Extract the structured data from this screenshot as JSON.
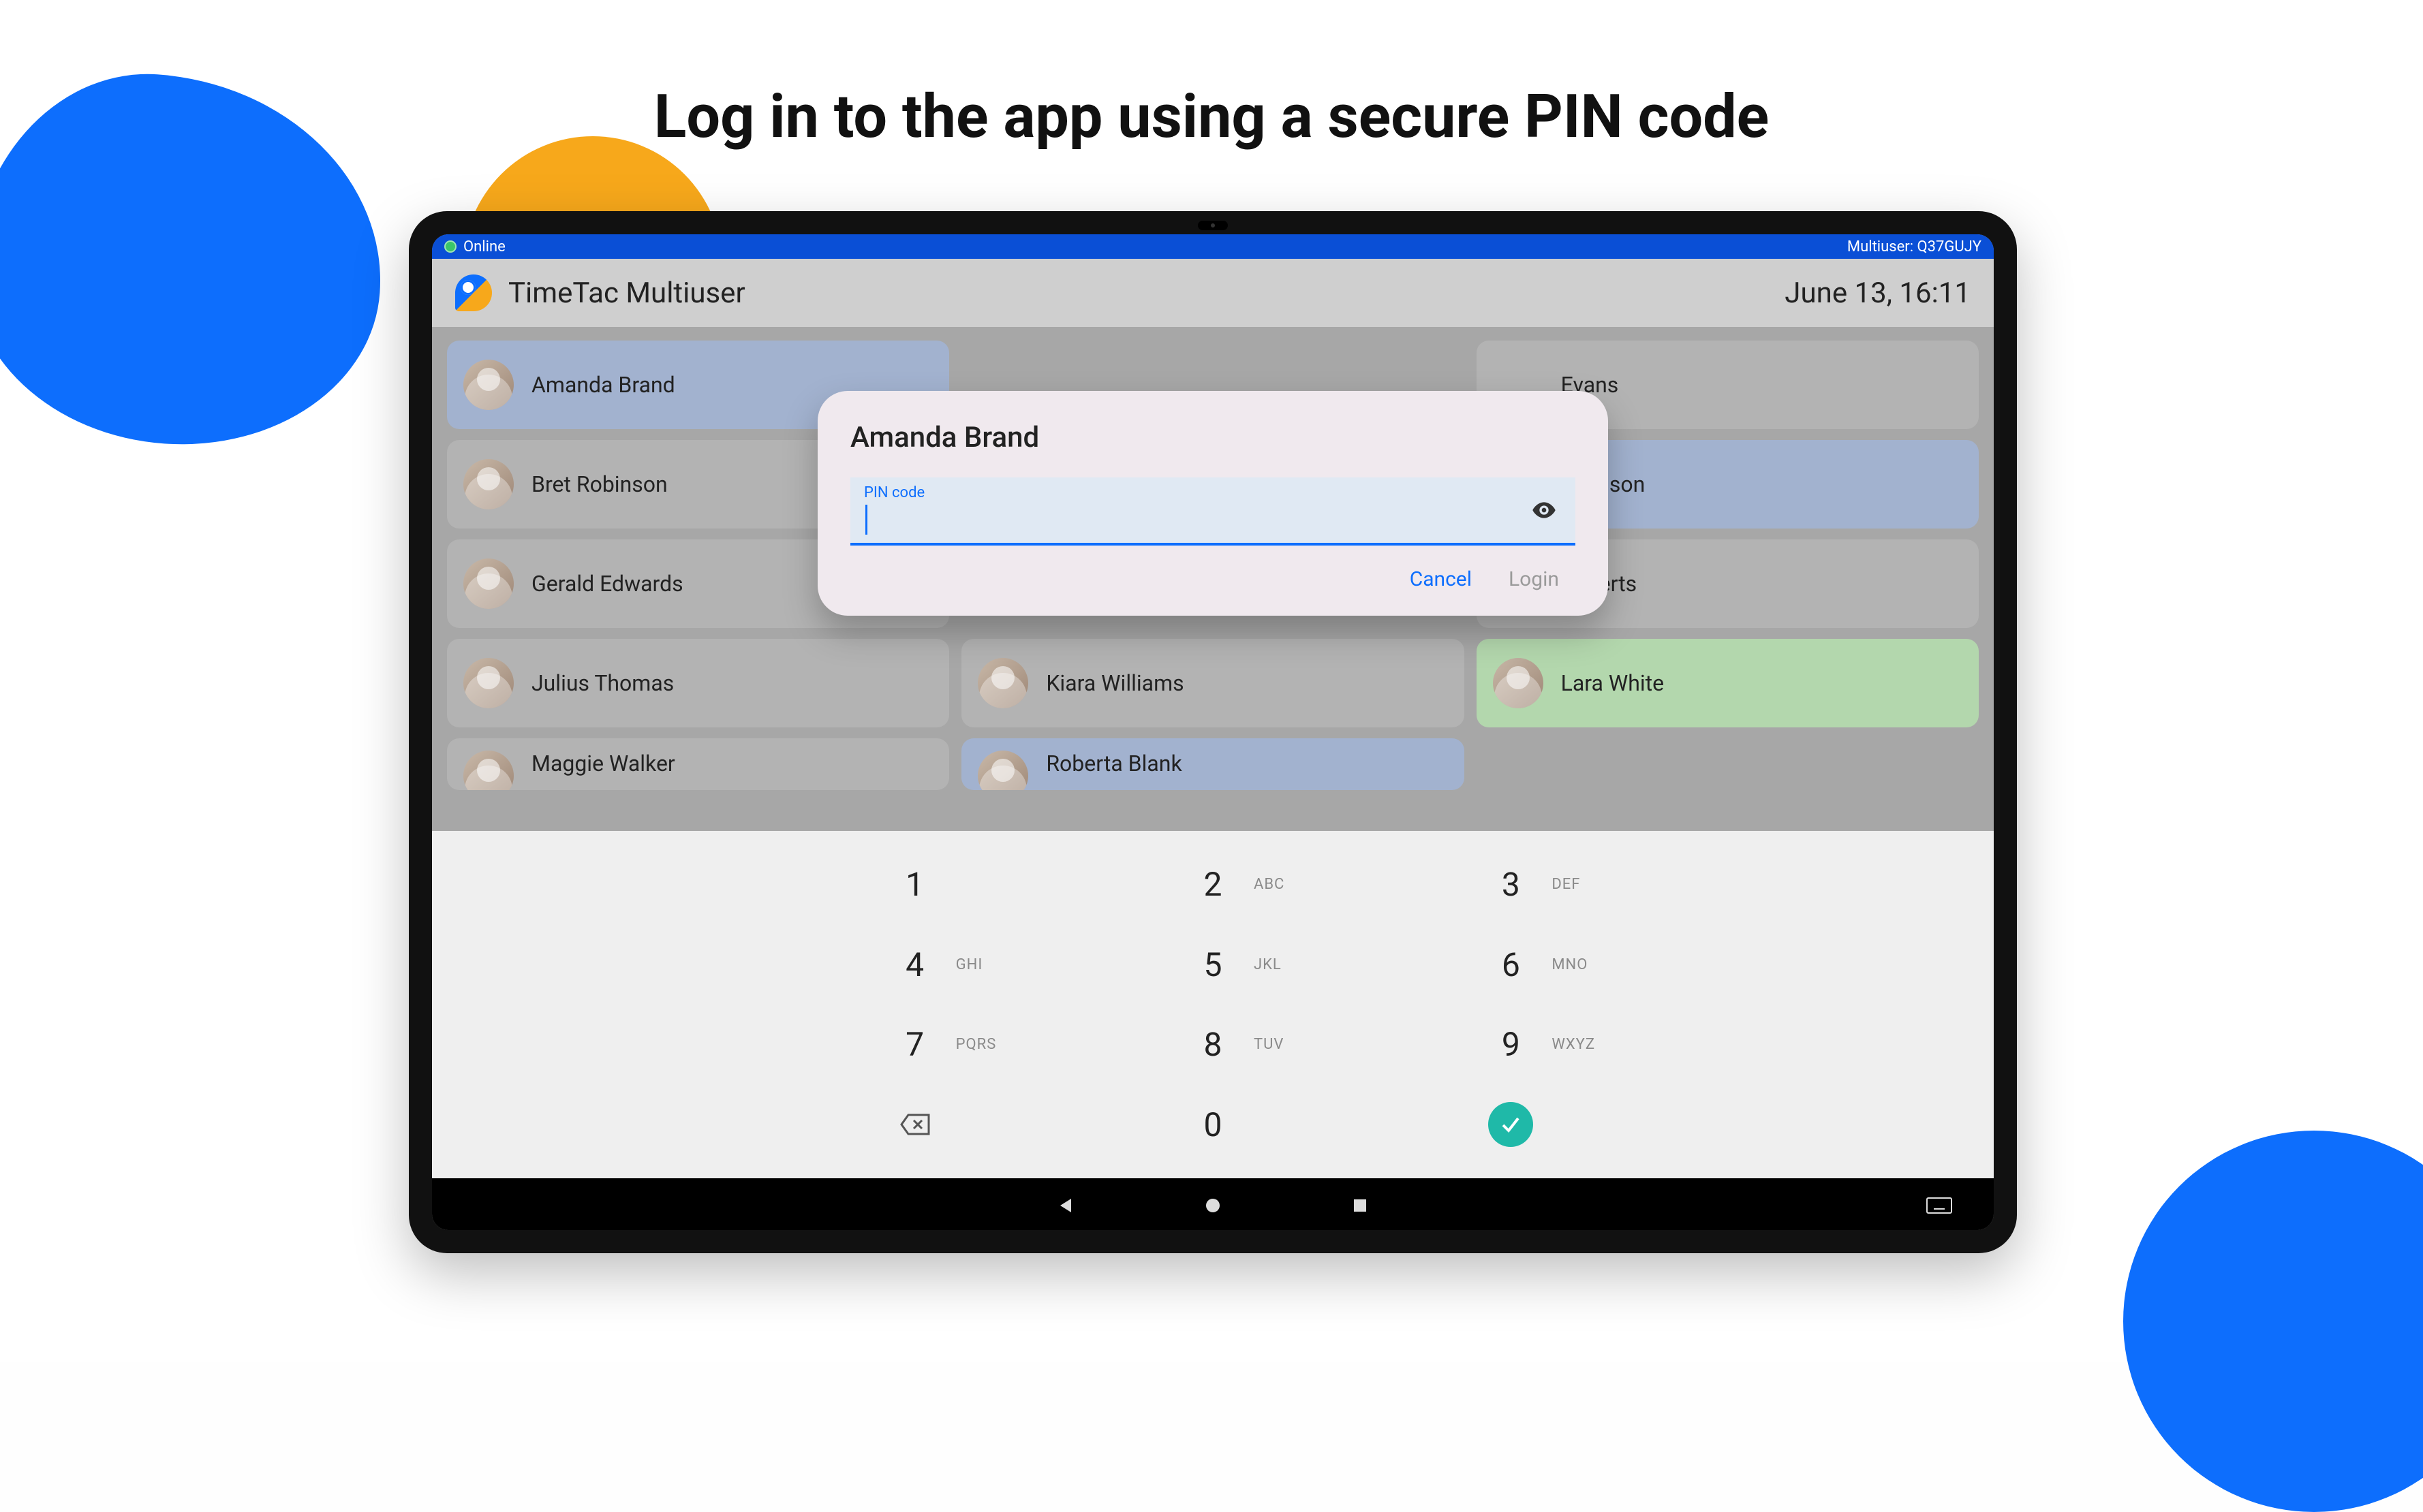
{
  "headline": "Log in to the app using a secure PIN code",
  "statusbar": {
    "online_label": "Online",
    "multiuser_label": "Multiuser: Q37GUJY"
  },
  "appheader": {
    "title": "TimeTac Multiuser",
    "clock": "June 13, 16:11"
  },
  "users": {
    "r1c1": "Amanda Brand",
    "r1c3_partial": "Evans",
    "r2c1": "Bret Robinson",
    "r2c3_partial": "Johnson",
    "r3c1": "Gerald Edwards",
    "r3c3_partial": "Roberts",
    "r4c1": "Julius Thomas",
    "r4c2": "Kiara Williams",
    "r4c3": "Lara White",
    "r5c1": "Maggie Walker",
    "r5c2": "Roberta Blank"
  },
  "modal": {
    "title": "Amanda Brand",
    "pin_label": "PIN code",
    "pin_value": "",
    "cancel": "Cancel",
    "login": "Login"
  },
  "keypad": {
    "k1": "1",
    "k2": "2",
    "l2": "ABC",
    "k3": "3",
    "l3": "DEF",
    "k4": "4",
    "l4": "GHI",
    "k5": "5",
    "l5": "JKL",
    "k6": "6",
    "l6": "MNO",
    "k7": "7",
    "l7": "PQRS",
    "k8": "8",
    "l8": "TUV",
    "k9": "9",
    "l9": "WXYZ",
    "k0": "0"
  }
}
